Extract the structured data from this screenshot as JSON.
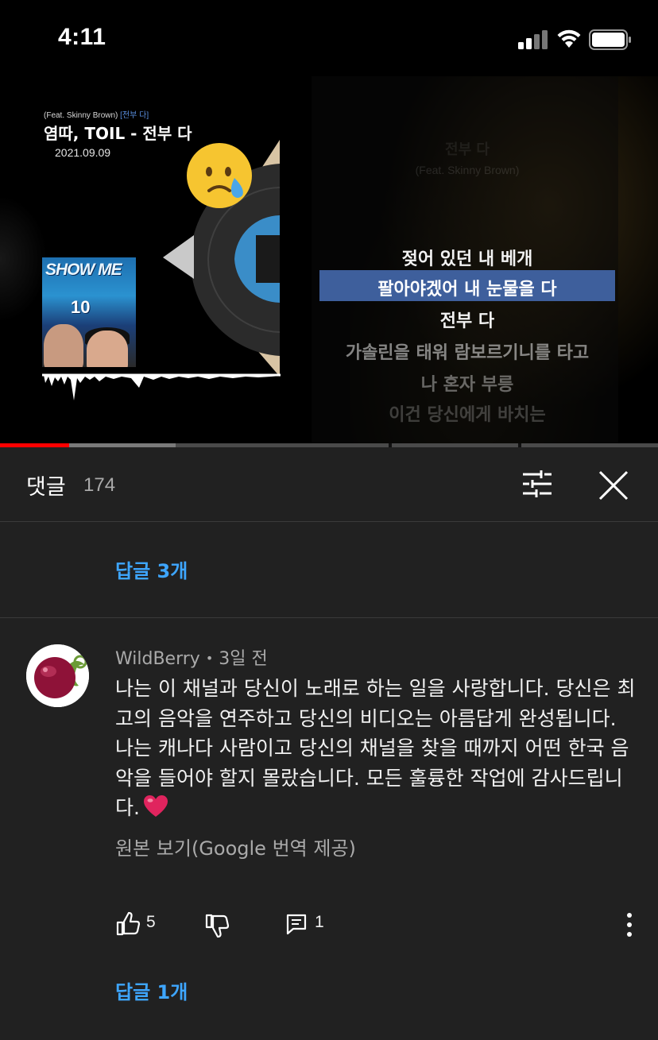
{
  "status_bar": {
    "time": "4:11"
  },
  "video": {
    "art_subtitle_prefix": "(Feat. Skinny Brown)",
    "art_subtitle_tag": "[전부 다]",
    "art_title": "염따, TOIL - 전부 다",
    "art_date": "2021.09.09",
    "cover_text_top": "SHOW ME",
    "cover_text_bottom": "10",
    "lyrics_heading": "전부 다",
    "lyrics_feat": "(Feat. Skinny Brown)",
    "lyrics": [
      "젖어 있던 내 베개",
      "팔아야겠어 내 눈물을 다",
      "전부 다",
      "가솔린을 태워 람보르기니를 타고",
      "나 혼자 부릉",
      "이건 당신에게 바치는"
    ],
    "highlighted_lyric_index": 1,
    "progress": {
      "played": 0.105,
      "buffered": 0.267
    }
  },
  "comments": {
    "title": "댓글",
    "count": "174",
    "prev_replies_label": "답글 3개",
    "comment": {
      "author": "WildBerry",
      "separator": "•",
      "time": "3일 전",
      "text": "나는 이 채널과 당신이 노래로 하는 일을 사랑합니다. 당신은 최고의 음악을 연주하고 당신의 비디오는 아름답게 완성됩니다. 나는 캐나다 사람이고 당신의 채널을 찾을 때까지 어떤 한국 음악을 들어야 할지 몰랐습니다. 모든 훌륭한 작업에 감사드립니다.",
      "emoji": "red-heart",
      "translate_label": "원본 보기(Google 번역 제공)",
      "likes": "5",
      "reply_count": "1",
      "replies_label": "답글 1개"
    }
  },
  "colors": {
    "panel_bg": "#212121",
    "link_blue": "#3ea6ff",
    "progress_red": "#ff0000",
    "lyric_highlight": "#3e5f9c"
  }
}
